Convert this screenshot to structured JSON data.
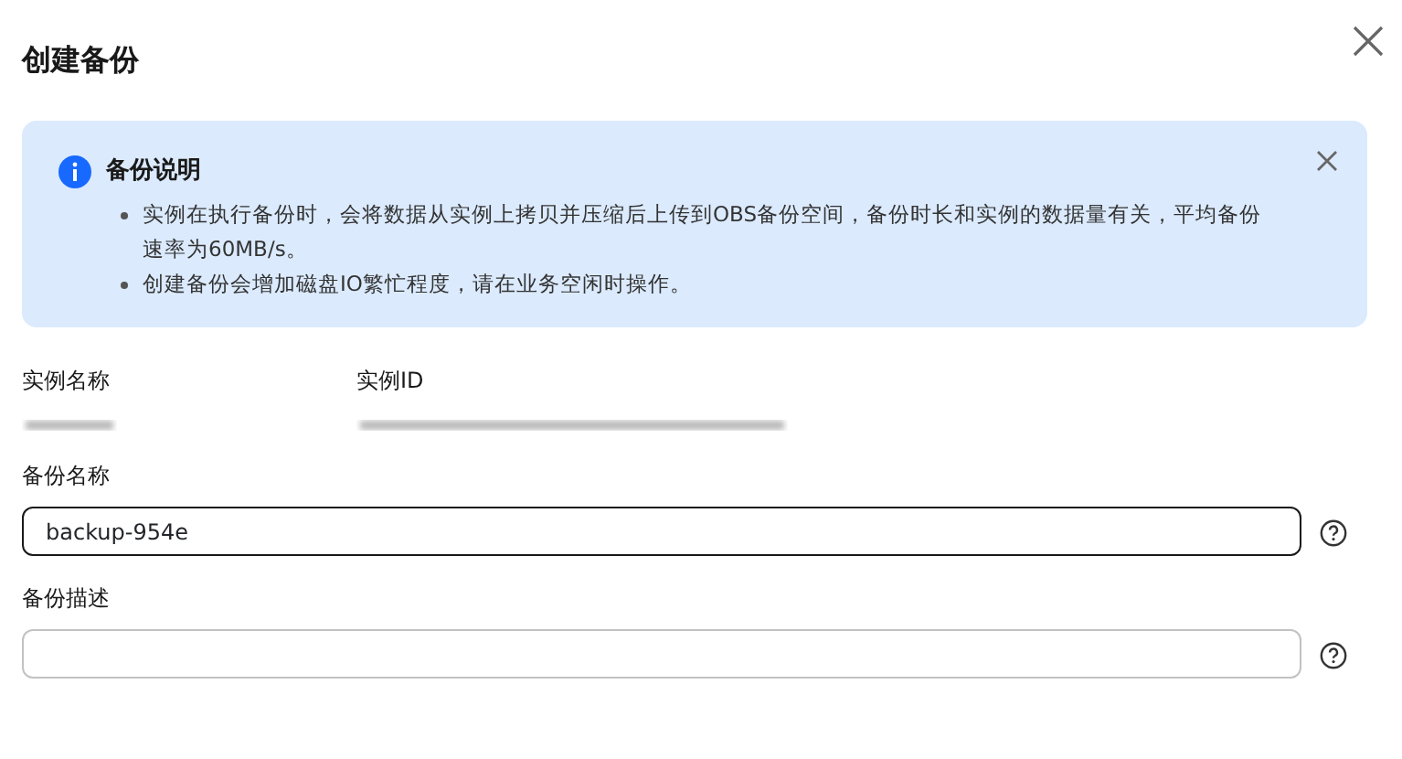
{
  "dialog": {
    "title": "创建备份"
  },
  "notice": {
    "title": "备份说明",
    "items": [
      "实例在执行备份时，会将数据从实例上拷贝并压缩后上传到OBS备份空间，备份时长和实例的数据量有关，平均备份速率为60MB/s。",
      "创建备份会增加磁盘IO繁忙程度，请在业务空闲时操作。"
    ]
  },
  "instance": {
    "name_label": "实例名称",
    "id_label": "实例ID"
  },
  "fields": [
    {
      "label": "备份名称",
      "value": "backup-954e",
      "focused": true
    },
    {
      "label": "备份描述",
      "focused": false
    }
  ]
}
